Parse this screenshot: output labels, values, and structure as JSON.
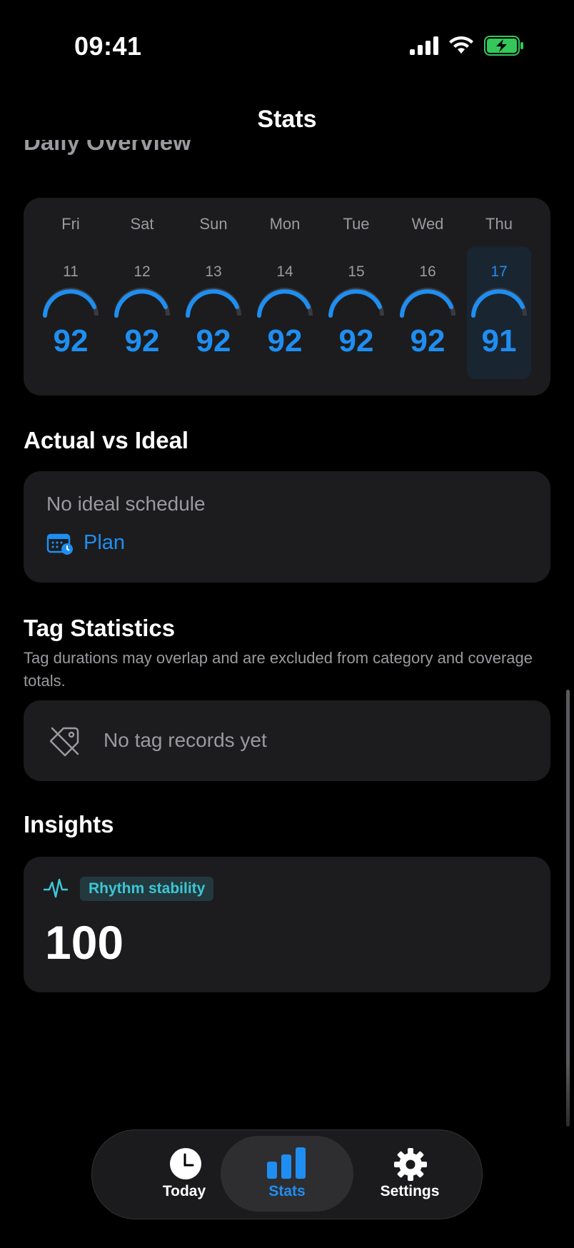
{
  "status_bar": {
    "time": "09:41"
  },
  "nav": {
    "title": "Stats"
  },
  "daily_overview": {
    "title": "Daily Overview",
    "days": [
      {
        "name": "Fri",
        "date": "11",
        "score": "92",
        "selected": false
      },
      {
        "name": "Sat",
        "date": "12",
        "score": "92",
        "selected": false
      },
      {
        "name": "Sun",
        "date": "13",
        "score": "92",
        "selected": false
      },
      {
        "name": "Mon",
        "date": "14",
        "score": "92",
        "selected": false
      },
      {
        "name": "Tue",
        "date": "15",
        "score": "92",
        "selected": false
      },
      {
        "name": "Wed",
        "date": "16",
        "score": "92",
        "selected": false
      },
      {
        "name": "Thu",
        "date": "17",
        "score": "91",
        "selected": true
      }
    ]
  },
  "actual_vs_ideal": {
    "title": "Actual vs Ideal",
    "empty_text": "No ideal schedule",
    "plan_label": "Plan"
  },
  "tag_statistics": {
    "title": "Tag Statistics",
    "subtitle": "Tag durations may overlap and are excluded from category and coverage totals.",
    "empty_text": "No tag records yet"
  },
  "insights": {
    "title": "Insights",
    "badge_label": "Rhythm stability",
    "value": "100"
  },
  "tab_bar": {
    "tabs": [
      {
        "label": "Today",
        "icon": "clock-icon",
        "active": false
      },
      {
        "label": "Stats",
        "icon": "bar-chart-icon",
        "active": true
      },
      {
        "label": "Settings",
        "icon": "gear-icon",
        "active": false
      }
    ]
  },
  "colors": {
    "accent": "#1f8ef1",
    "teal": "#3cc6d6",
    "card": "#1c1c1e",
    "battery": "#34c759"
  }
}
